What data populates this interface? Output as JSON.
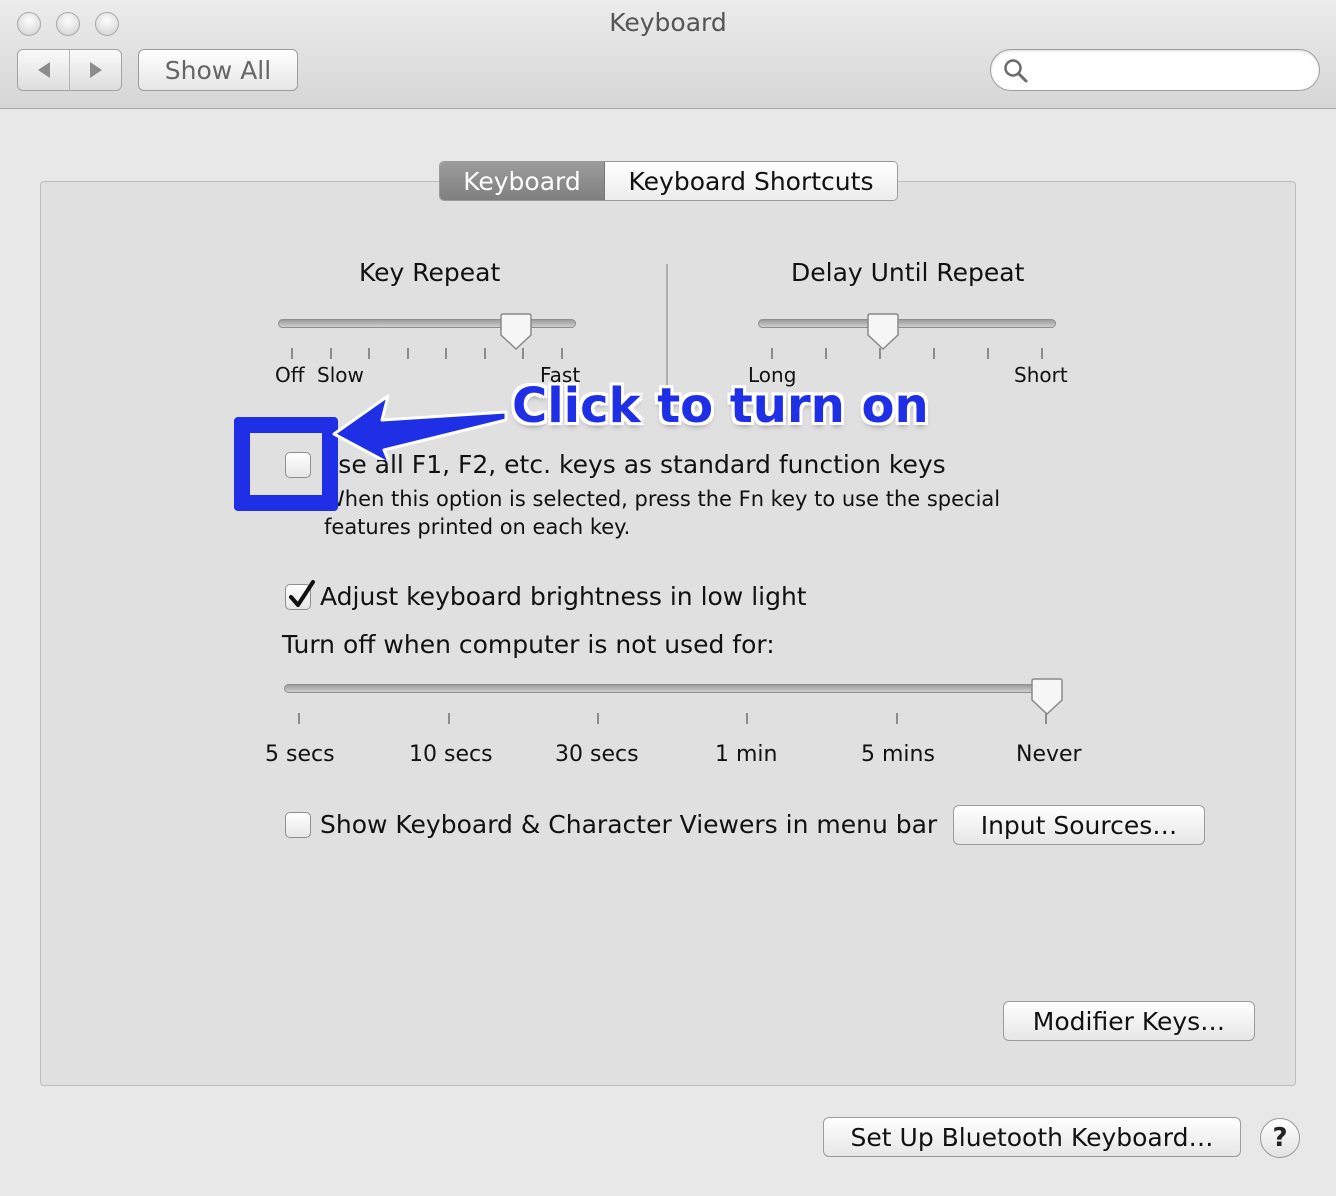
{
  "window": {
    "title": "Keyboard",
    "nav_back_icon": "triangle-left",
    "nav_forward_icon": "triangle-right",
    "show_all_label": "Show All",
    "search_placeholder": ""
  },
  "tabs": [
    {
      "label": "Keyboard",
      "selected": true
    },
    {
      "label": "Keyboard Shortcuts",
      "selected": false
    }
  ],
  "key_repeat": {
    "title": "Key Repeat",
    "tick_labels": [
      "Off",
      "Slow",
      "Fast"
    ],
    "tick_count": 8,
    "value_fraction": 0.83
  },
  "delay_until_repeat": {
    "title": "Delay Until Repeat",
    "tick_labels": [
      "Long",
      "Short"
    ],
    "tick_count": 6,
    "value_fraction": 0.41
  },
  "function_keys": {
    "checked": false,
    "label": "Use all F1, F2, etc. keys as standard function keys",
    "description_line1": "When this option is selected, press the Fn key to use the special",
    "description_line2": "features printed on each key."
  },
  "brightness": {
    "checked": true,
    "label": "Adjust keyboard brightness in low light",
    "turn_off_label": "Turn off when computer is not used for:",
    "tick_labels": [
      "5 secs",
      "10 secs",
      "30 secs",
      "1 min",
      "5 mins",
      "Never"
    ],
    "selected": "Never"
  },
  "viewers": {
    "checked": false,
    "label": "Show Keyboard & Character Viewers in menu bar"
  },
  "buttons": {
    "input_sources": "Input Sources…",
    "modifier_keys": "Modifier Keys…",
    "bluetooth": "Set Up Bluetooth Keyboard…",
    "help": "?"
  },
  "annotation": {
    "text": "Click to turn on",
    "color": "#1e2fe6"
  }
}
